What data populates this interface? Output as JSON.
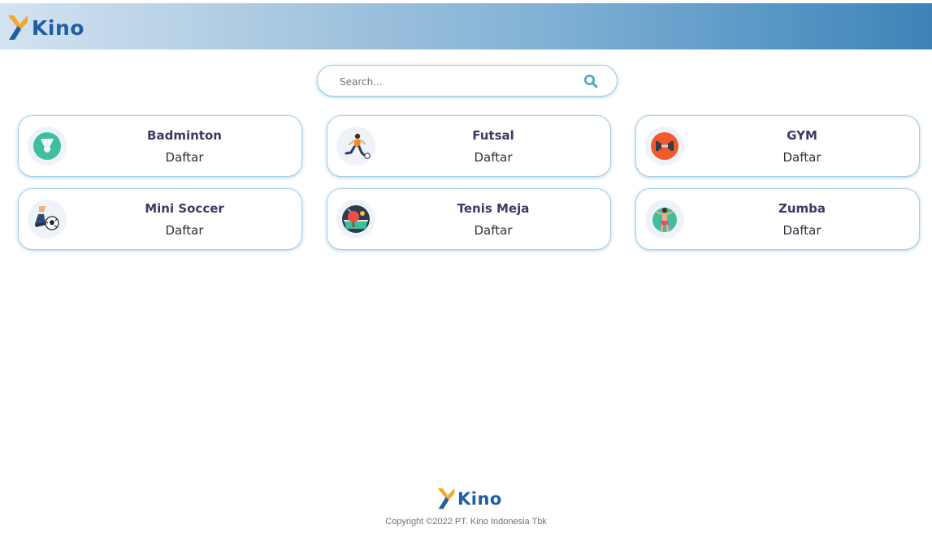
{
  "brand": {
    "name": "Kino",
    "accent": "#1d5fa4",
    "mark_colors": [
      "#f5a623",
      "#1d5fa4"
    ]
  },
  "search": {
    "placeholder": "Search...",
    "icon": "search-icon",
    "icon_color": "#4aa8b7"
  },
  "activities": [
    {
      "name": "Badminton",
      "action": "Daftar",
      "icon": "shuttlecock-icon"
    },
    {
      "name": "Futsal",
      "action": "Daftar",
      "icon": "futsal-player-icon"
    },
    {
      "name": "GYM",
      "action": "Daftar",
      "icon": "dumbbell-icon"
    },
    {
      "name": "Mini Soccer",
      "action": "Daftar",
      "icon": "soccer-boot-ball-icon"
    },
    {
      "name": "Tenis Meja",
      "action": "Daftar",
      "icon": "table-tennis-icon"
    },
    {
      "name": "Zumba",
      "action": "Daftar",
      "icon": "zumba-dancer-icon"
    }
  ],
  "footer": {
    "brand": "Kino",
    "copyright": "Copyright ©2022 PT. Kino Indonesia Tbk"
  }
}
